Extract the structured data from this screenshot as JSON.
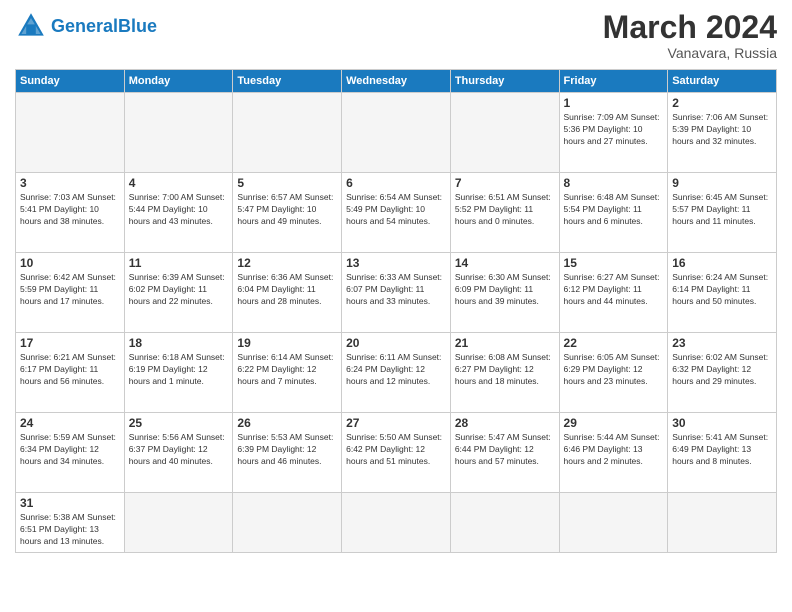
{
  "header": {
    "logo_general": "General",
    "logo_blue": "Blue",
    "title": "March 2024",
    "location": "Vanavara, Russia"
  },
  "weekdays": [
    "Sunday",
    "Monday",
    "Tuesday",
    "Wednesday",
    "Thursday",
    "Friday",
    "Saturday"
  ],
  "weeks": [
    [
      {
        "day": "",
        "info": ""
      },
      {
        "day": "",
        "info": ""
      },
      {
        "day": "",
        "info": ""
      },
      {
        "day": "",
        "info": ""
      },
      {
        "day": "",
        "info": ""
      },
      {
        "day": "1",
        "info": "Sunrise: 7:09 AM\nSunset: 5:36 PM\nDaylight: 10 hours and 27 minutes."
      },
      {
        "day": "2",
        "info": "Sunrise: 7:06 AM\nSunset: 5:39 PM\nDaylight: 10 hours and 32 minutes."
      }
    ],
    [
      {
        "day": "3",
        "info": "Sunrise: 7:03 AM\nSunset: 5:41 PM\nDaylight: 10 hours and 38 minutes."
      },
      {
        "day": "4",
        "info": "Sunrise: 7:00 AM\nSunset: 5:44 PM\nDaylight: 10 hours and 43 minutes."
      },
      {
        "day": "5",
        "info": "Sunrise: 6:57 AM\nSunset: 5:47 PM\nDaylight: 10 hours and 49 minutes."
      },
      {
        "day": "6",
        "info": "Sunrise: 6:54 AM\nSunset: 5:49 PM\nDaylight: 10 hours and 54 minutes."
      },
      {
        "day": "7",
        "info": "Sunrise: 6:51 AM\nSunset: 5:52 PM\nDaylight: 11 hours and 0 minutes."
      },
      {
        "day": "8",
        "info": "Sunrise: 6:48 AM\nSunset: 5:54 PM\nDaylight: 11 hours and 6 minutes."
      },
      {
        "day": "9",
        "info": "Sunrise: 6:45 AM\nSunset: 5:57 PM\nDaylight: 11 hours and 11 minutes."
      }
    ],
    [
      {
        "day": "10",
        "info": "Sunrise: 6:42 AM\nSunset: 5:59 PM\nDaylight: 11 hours and 17 minutes."
      },
      {
        "day": "11",
        "info": "Sunrise: 6:39 AM\nSunset: 6:02 PM\nDaylight: 11 hours and 22 minutes."
      },
      {
        "day": "12",
        "info": "Sunrise: 6:36 AM\nSunset: 6:04 PM\nDaylight: 11 hours and 28 minutes."
      },
      {
        "day": "13",
        "info": "Sunrise: 6:33 AM\nSunset: 6:07 PM\nDaylight: 11 hours and 33 minutes."
      },
      {
        "day": "14",
        "info": "Sunrise: 6:30 AM\nSunset: 6:09 PM\nDaylight: 11 hours and 39 minutes."
      },
      {
        "day": "15",
        "info": "Sunrise: 6:27 AM\nSunset: 6:12 PM\nDaylight: 11 hours and 44 minutes."
      },
      {
        "day": "16",
        "info": "Sunrise: 6:24 AM\nSunset: 6:14 PM\nDaylight: 11 hours and 50 minutes."
      }
    ],
    [
      {
        "day": "17",
        "info": "Sunrise: 6:21 AM\nSunset: 6:17 PM\nDaylight: 11 hours and 56 minutes."
      },
      {
        "day": "18",
        "info": "Sunrise: 6:18 AM\nSunset: 6:19 PM\nDaylight: 12 hours and 1 minute."
      },
      {
        "day": "19",
        "info": "Sunrise: 6:14 AM\nSunset: 6:22 PM\nDaylight: 12 hours and 7 minutes."
      },
      {
        "day": "20",
        "info": "Sunrise: 6:11 AM\nSunset: 6:24 PM\nDaylight: 12 hours and 12 minutes."
      },
      {
        "day": "21",
        "info": "Sunrise: 6:08 AM\nSunset: 6:27 PM\nDaylight: 12 hours and 18 minutes."
      },
      {
        "day": "22",
        "info": "Sunrise: 6:05 AM\nSunset: 6:29 PM\nDaylight: 12 hours and 23 minutes."
      },
      {
        "day": "23",
        "info": "Sunrise: 6:02 AM\nSunset: 6:32 PM\nDaylight: 12 hours and 29 minutes."
      }
    ],
    [
      {
        "day": "24",
        "info": "Sunrise: 5:59 AM\nSunset: 6:34 PM\nDaylight: 12 hours and 34 minutes."
      },
      {
        "day": "25",
        "info": "Sunrise: 5:56 AM\nSunset: 6:37 PM\nDaylight: 12 hours and 40 minutes."
      },
      {
        "day": "26",
        "info": "Sunrise: 5:53 AM\nSunset: 6:39 PM\nDaylight: 12 hours and 46 minutes."
      },
      {
        "day": "27",
        "info": "Sunrise: 5:50 AM\nSunset: 6:42 PM\nDaylight: 12 hours and 51 minutes."
      },
      {
        "day": "28",
        "info": "Sunrise: 5:47 AM\nSunset: 6:44 PM\nDaylight: 12 hours and 57 minutes."
      },
      {
        "day": "29",
        "info": "Sunrise: 5:44 AM\nSunset: 6:46 PM\nDaylight: 13 hours and 2 minutes."
      },
      {
        "day": "30",
        "info": "Sunrise: 5:41 AM\nSunset: 6:49 PM\nDaylight: 13 hours and 8 minutes."
      }
    ],
    [
      {
        "day": "31",
        "info": "Sunrise: 5:38 AM\nSunset: 6:51 PM\nDaylight: 13 hours and 13 minutes."
      },
      {
        "day": "",
        "info": ""
      },
      {
        "day": "",
        "info": ""
      },
      {
        "day": "",
        "info": ""
      },
      {
        "day": "",
        "info": ""
      },
      {
        "day": "",
        "info": ""
      },
      {
        "day": "",
        "info": ""
      }
    ]
  ]
}
